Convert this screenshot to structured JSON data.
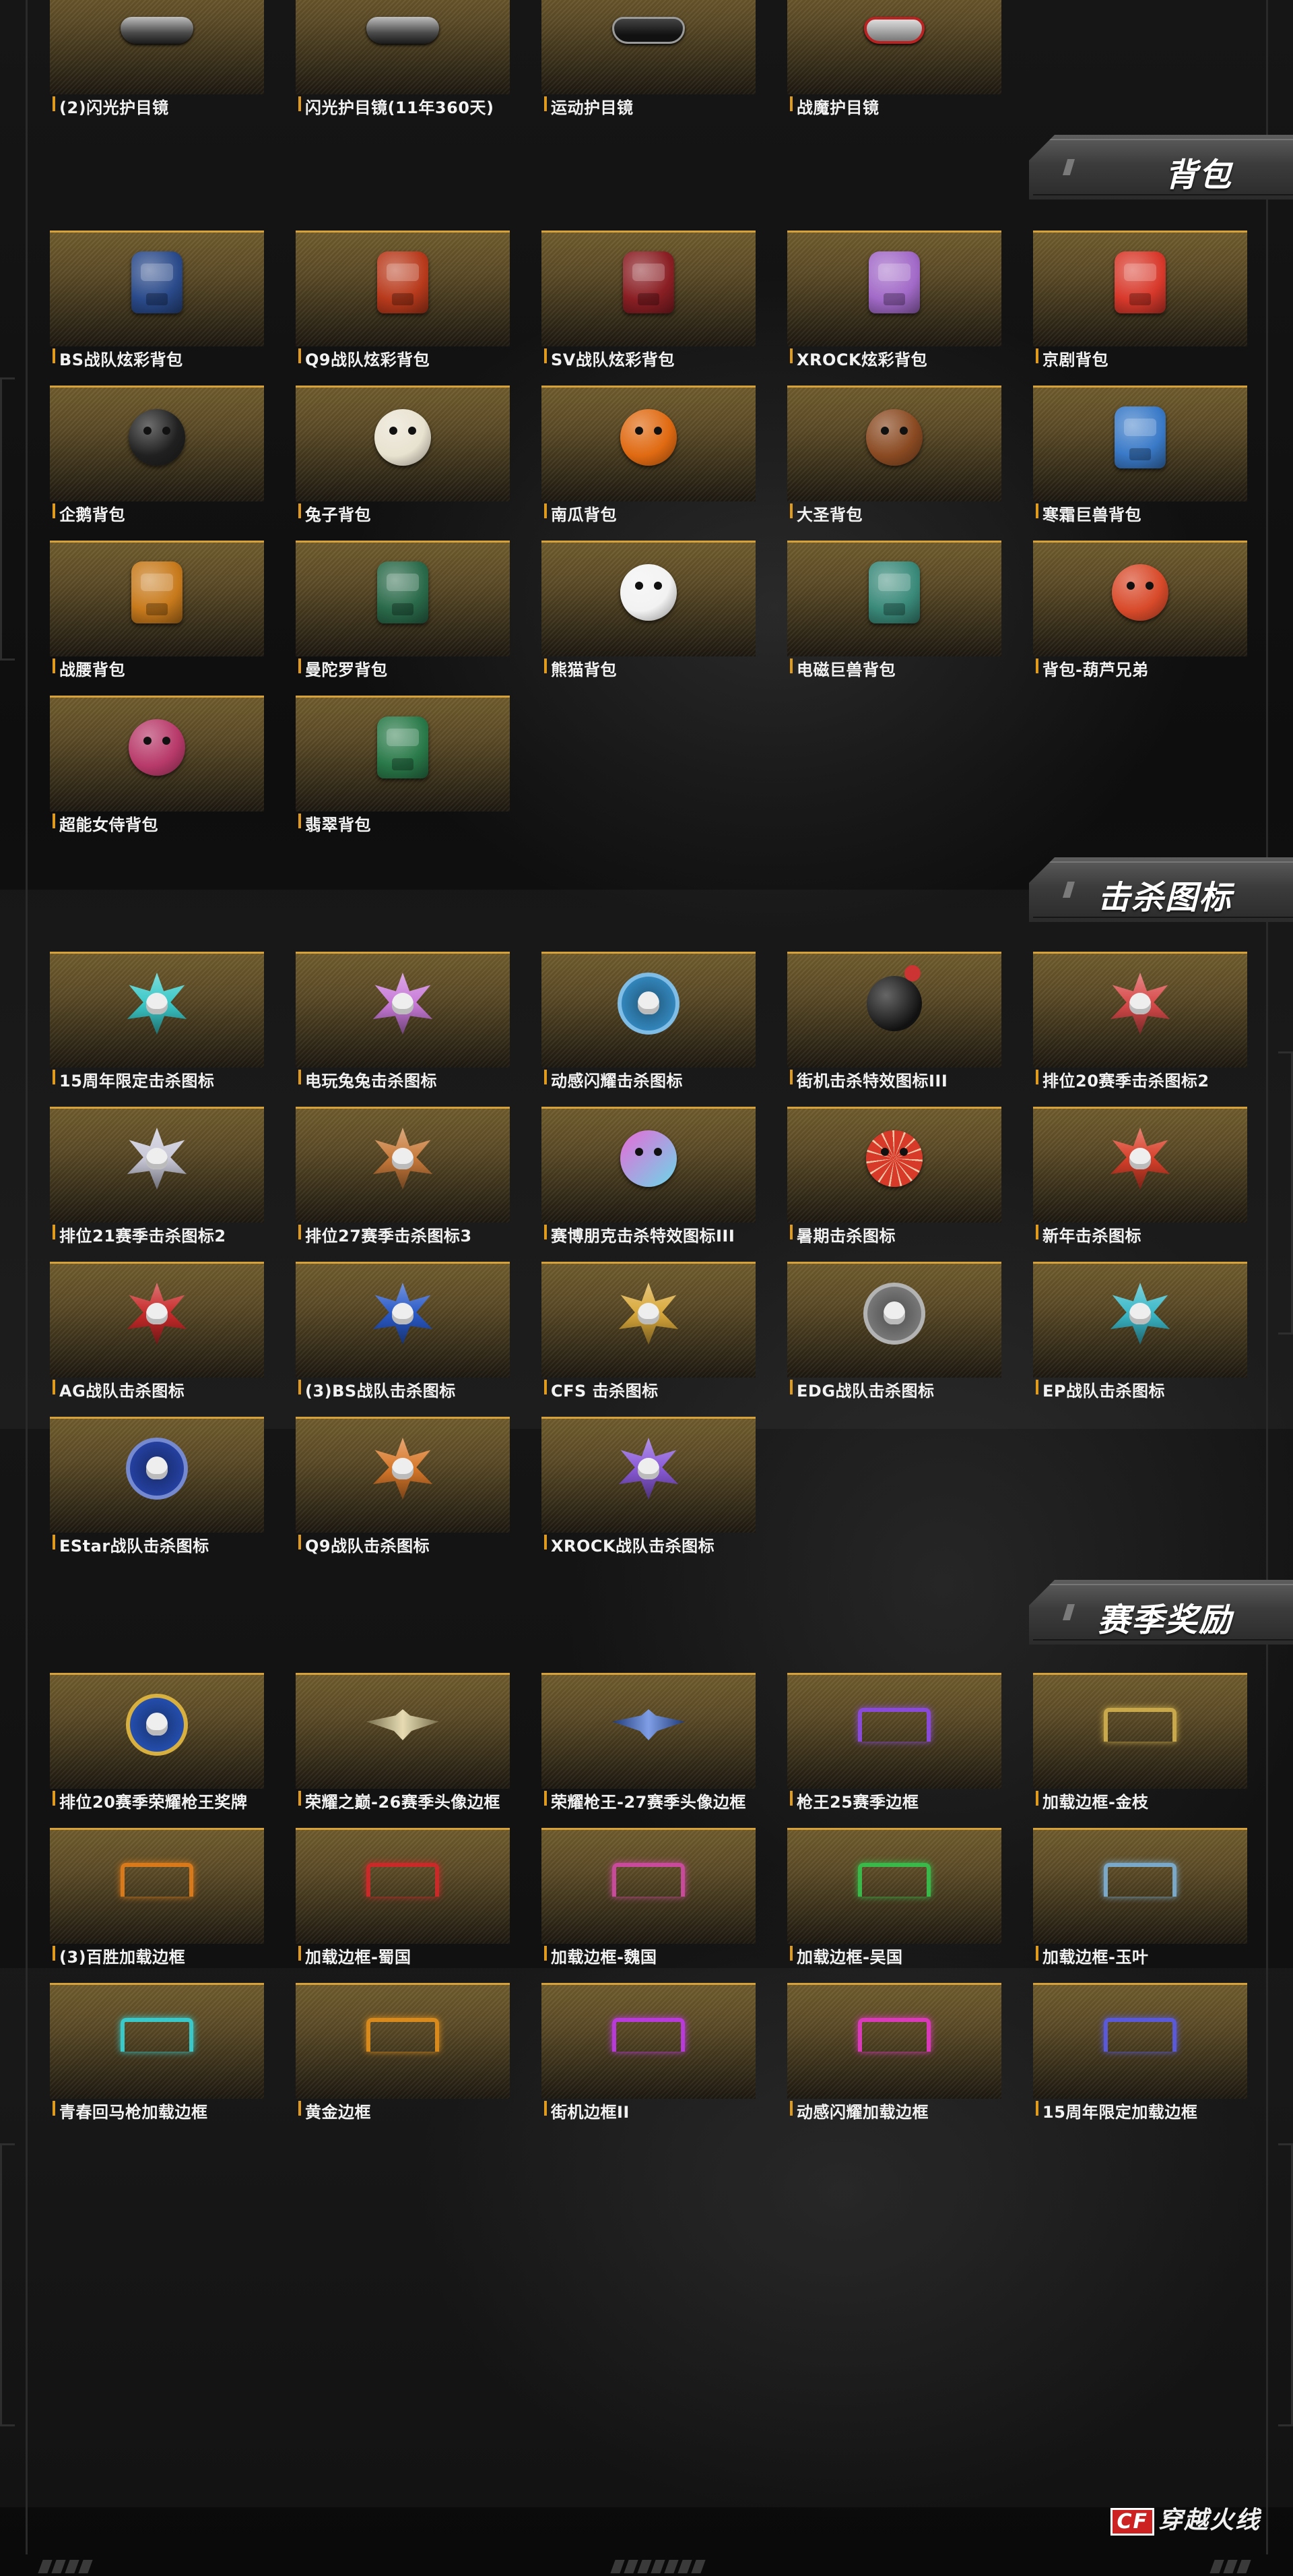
{
  "colors": {
    "accent_orange": "#e09a1c",
    "card_gold": "#6f5b2d",
    "background": "#0e0e0e"
  },
  "sections": {
    "goggles_tail": {
      "items": [
        {
          "label": "(2)闪光护目镜",
          "icon": "goggles-icon"
        },
        {
          "label": "闪光护目镜(11年360天)",
          "icon": "goggles-icon"
        },
        {
          "label": "运动护目镜",
          "icon": "sport-goggles-icon"
        },
        {
          "label": "战魔护目镜",
          "icon": "demon-goggles-icon"
        }
      ]
    },
    "backpacks": {
      "title": "背包",
      "items": [
        {
          "label": "BS战队炫彩背包",
          "icon": "backpack-icon",
          "color": "#2a4a8a"
        },
        {
          "label": "Q9战队炫彩背包",
          "icon": "backpack-icon",
          "color": "#b83a1c"
        },
        {
          "label": "SV战队炫彩背包",
          "icon": "backpack-icon",
          "color": "#8a1f24"
        },
        {
          "label": "XROCK炫彩背包",
          "icon": "backpack-icon",
          "color": "#a26ac8"
        },
        {
          "label": "京剧背包",
          "icon": "opera-backpack-icon",
          "color": "#d8392b"
        },
        {
          "label": "企鹅背包",
          "icon": "penguin-backpack-icon",
          "color": "#202020"
        },
        {
          "label": "兔子背包",
          "icon": "rabbit-backpack-icon",
          "color": "#e8e2d0"
        },
        {
          "label": "南瓜背包",
          "icon": "pumpkin-backpack-icon",
          "color": "#e06a12"
        },
        {
          "label": "大圣背包",
          "icon": "monkey-backpack-icon",
          "color": "#8a4a22"
        },
        {
          "label": "寒霜巨兽背包",
          "icon": "frost-beast-backpack-icon",
          "color": "#3a7ac8"
        },
        {
          "label": "战腰背包",
          "icon": "jetpack-icon",
          "color": "#c87a1c"
        },
        {
          "label": "曼陀罗背包",
          "icon": "mandala-backpack-icon",
          "color": "#2a6a4a"
        },
        {
          "label": "熊猫背包",
          "icon": "panda-backpack-icon",
          "color": "#f2f2f2"
        },
        {
          "label": "电磁巨兽背包",
          "icon": "electromagnetic-backpack-icon",
          "color": "#3a8a7a"
        },
        {
          "label": "背包-葫芦兄弟",
          "icon": "calabash-backpack-icon",
          "color": "#d84a2a"
        },
        {
          "label": "超能女侍背包",
          "icon": "maid-backpack-icon",
          "color": "#b83a6a"
        },
        {
          "label": "翡翠背包",
          "icon": "jade-backpack-icon",
          "color": "#2a7a4a"
        }
      ]
    },
    "kill_icons": {
      "title": "击杀图标",
      "items": [
        {
          "label": "15周年限定击杀图标",
          "icon": "kill-emblem-icon",
          "color": "#3ac8c8"
        },
        {
          "label": "电玩兔兔击杀图标",
          "icon": "kill-emblem-icon",
          "color": "#c87ad8"
        },
        {
          "label": "动感闪耀击杀图标",
          "icon": "kill-medal-icon",
          "color": "#3a9ad8"
        },
        {
          "label": "街机击杀特效图标III",
          "icon": "bomb-icon",
          "color": "#222222"
        },
        {
          "label": "排位20赛季击杀图标2",
          "icon": "kill-emblem-icon",
          "color": "#d84a4a"
        },
        {
          "label": "排位21赛季击杀图标2",
          "icon": "kill-emblem-icon",
          "color": "#c8c8d8"
        },
        {
          "label": "排位27赛季击杀图标3",
          "icon": "kill-emblem-icon",
          "color": "#c87a3a"
        },
        {
          "label": "赛博朋克击杀特效图标III",
          "icon": "smiley-icon",
          "color": "#a86ad8"
        },
        {
          "label": "暑期击杀图标",
          "icon": "watermelon-icon",
          "color": "#d83a2a"
        },
        {
          "label": "新年击杀图标",
          "icon": "kill-emblem-icon",
          "color": "#d8402a"
        },
        {
          "label": "AG战队击杀图标",
          "icon": "kill-emblem-icon",
          "color": "#c82a2a"
        },
        {
          "label": "(3)BS战队击杀图标",
          "icon": "kill-emblem-icon",
          "color": "#2a5ac8"
        },
        {
          "label": "CFS 击杀图标",
          "icon": "kill-emblem-icon",
          "color": "#d8a83a"
        },
        {
          "label": "EDG战队击杀图标",
          "icon": "kill-medal-icon",
          "color": "#8a8a8a"
        },
        {
          "label": "EP战队击杀图标",
          "icon": "kill-emblem-icon",
          "color": "#3ab8c8"
        },
        {
          "label": "EStar战队击杀图标",
          "icon": "kill-medal-icon",
          "color": "#2a4ab8"
        },
        {
          "label": "Q9战队击杀图标",
          "icon": "kill-emblem-icon",
          "color": "#d8782a"
        },
        {
          "label": "XROCK战队击杀图标",
          "icon": "kill-emblem-icon",
          "color": "#8a5ad8"
        }
      ]
    },
    "season_rewards": {
      "title": "赛季奖励",
      "items": [
        {
          "label": "排位20赛季荣耀枪王奖牌",
          "icon": "medal-icon",
          "color": "#2a5ac8"
        },
        {
          "label": "荣耀之巅-26赛季头像边框",
          "icon": "wings-frame-icon",
          "color": "#d8c88a"
        },
        {
          "label": "荣耀枪王-27赛季头像边框",
          "icon": "wings-frame-icon",
          "color": "#3a6ad8"
        },
        {
          "label": "枪王25赛季边框",
          "icon": "banner-frame-icon",
          "color": "#8a4ad8"
        },
        {
          "label": "加载边框-金枝",
          "icon": "banner-frame-icon",
          "color": "#c8a84a"
        },
        {
          "label": "(3)百胜加载边框",
          "icon": "banner-frame-icon",
          "color": "#d87a1c"
        },
        {
          "label": "加载边框-蜀国",
          "icon": "banner-frame-icon",
          "color": "#c82a2a"
        },
        {
          "label": "加载边框-魏国",
          "icon": "banner-frame-icon",
          "color": "#c84a9a"
        },
        {
          "label": "加载边框-吴国",
          "icon": "banner-frame-icon",
          "color": "#3ab84a"
        },
        {
          "label": "加载边框-玉叶",
          "icon": "banner-frame-icon",
          "color": "#7aa8c8"
        },
        {
          "label": "青春回马枪加载边框",
          "icon": "banner-frame-icon",
          "color": "#3ac8c8"
        },
        {
          "label": "黄金边框",
          "icon": "banner-frame-icon",
          "color": "#d88a1c"
        },
        {
          "label": "街机边框II",
          "icon": "banner-frame-icon",
          "color": "#b83ad8"
        },
        {
          "label": "动感闪耀加载边框",
          "icon": "banner-frame-icon",
          "color": "#d83ab8"
        },
        {
          "label": "15周年限定加载边框",
          "icon": "banner-frame-icon",
          "color": "#5a5ad8"
        }
      ]
    }
  },
  "footer": {
    "logo_text": "穿越火线",
    "logo_badge": "CF"
  }
}
